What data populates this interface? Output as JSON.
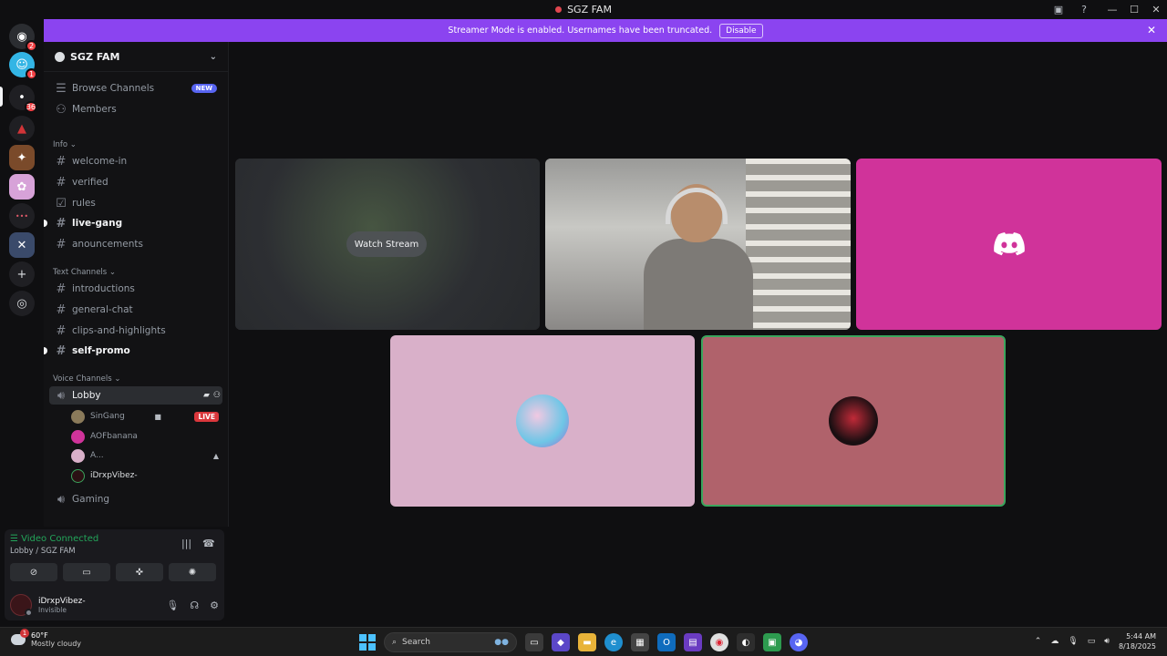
{
  "window": {
    "title": "SGZ FAM",
    "controls": [
      "—",
      "☐",
      "✕"
    ]
  },
  "banner": {
    "text": "Streamer Mode is enabled. Usernames have been truncated.",
    "button": "Disable"
  },
  "rail": {
    "badges": [
      "2",
      "1",
      "36"
    ]
  },
  "guild": {
    "name": "SGZ FAM"
  },
  "sidebar": {
    "browse_channels": "Browse Channels",
    "new_tag": "NEW",
    "members": "Members",
    "category_info": "Info",
    "info_channels": [
      "welcome-in",
      "verified",
      "rules",
      "live-gang",
      "anouncements"
    ],
    "category_text": "Text Channels",
    "text_channels": [
      "introductions",
      "general-chat",
      "clips-and-highlights",
      "self-promo"
    ],
    "category_voice": "Voice Channels",
    "voice_lobby": "Lobby",
    "voice_users": [
      "SinGang",
      "AOFbanana",
      "A...",
      "iDrxpVibez-"
    ],
    "live_tag": "LIVE",
    "voice_gaming": "Gaming"
  },
  "voice_panel": {
    "status": "Video Connected",
    "location": "Lobby / SGZ FAM"
  },
  "user": {
    "name": "iDrxpVibez-",
    "status": "Invisible"
  },
  "stage": {
    "watch_stream": "Watch Stream"
  },
  "taskbar": {
    "weather_temp": "60°F",
    "weather_desc": "Mostly cloudy",
    "weather_badge": "1",
    "search_placeholder": "Search",
    "time": "5:44 AM",
    "date": "8/18/2025"
  },
  "colors": {
    "banner": "#8b44f0",
    "connected": "#23a55a",
    "live": "#da373c",
    "tile_pink": "#d0339a",
    "tile_lightpink": "#d9b0c9",
    "tile_rose": "#b0626b",
    "speaking_border": "#3ba55d"
  }
}
